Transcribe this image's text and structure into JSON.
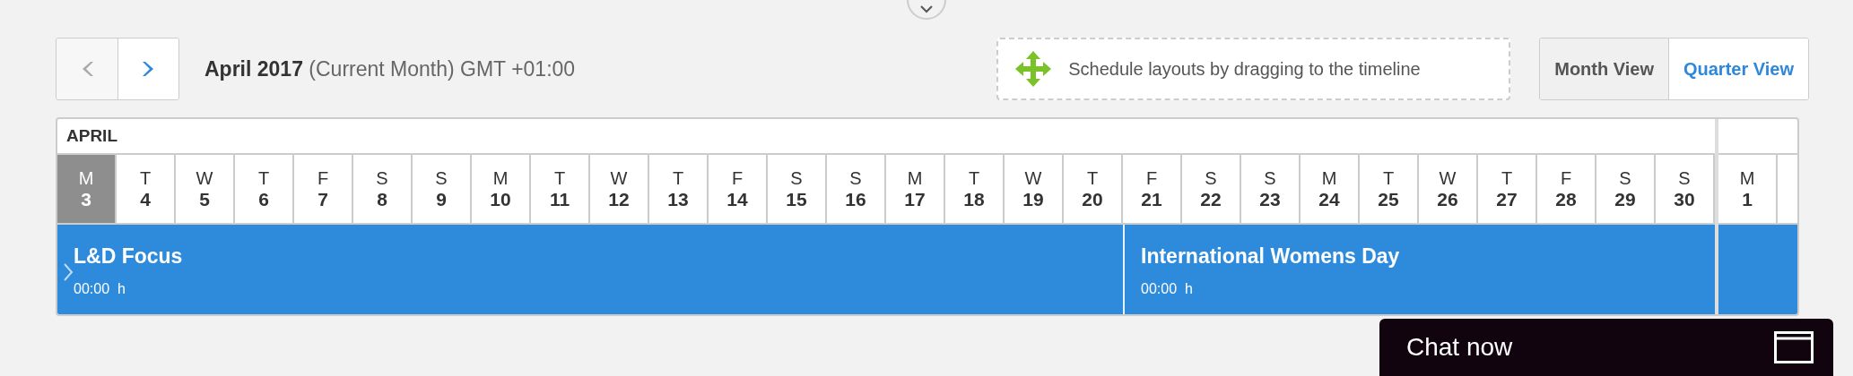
{
  "toolbar": {
    "prev_disabled": true,
    "title": "April 2017",
    "subtitle": "(Current Month) GMT +01:00",
    "hint": "Schedule layouts by dragging to the timeline",
    "views": [
      {
        "label": "Month View",
        "selected": true
      },
      {
        "label": "Quarter View",
        "selected": false
      }
    ]
  },
  "timeline": {
    "expanded": false,
    "months": [
      {
        "name": "APRIL",
        "days": [
          {
            "letter": "M",
            "date": "3",
            "today": true,
            "event": {
              "kind": "titled",
              "title": "L&D Focus",
              "time": "00:00  h"
            }
          },
          {
            "letter": "T",
            "date": "4",
            "today": false
          },
          {
            "letter": "W",
            "date": "5",
            "today": false
          },
          {
            "letter": "T",
            "date": "6",
            "today": false
          },
          {
            "letter": "F",
            "date": "7",
            "today": false
          },
          {
            "letter": "S",
            "date": "8",
            "today": false
          },
          {
            "letter": "S",
            "date": "9",
            "today": false
          },
          {
            "letter": "M",
            "date": "10",
            "today": false
          },
          {
            "letter": "T",
            "date": "11",
            "today": false
          },
          {
            "letter": "W",
            "date": "12",
            "today": false
          },
          {
            "letter": "T",
            "date": "13",
            "today": false
          },
          {
            "letter": "F",
            "date": "14",
            "today": false
          },
          {
            "letter": "S",
            "date": "15",
            "today": false
          },
          {
            "letter": "S",
            "date": "16",
            "today": false
          },
          {
            "letter": "M",
            "date": "17",
            "today": false
          },
          {
            "letter": "T",
            "date": "18",
            "today": false
          },
          {
            "letter": "W",
            "date": "19",
            "today": false
          },
          {
            "letter": "T",
            "date": "20",
            "today": false
          },
          {
            "letter": "F",
            "date": "21",
            "today": false,
            "event": {
              "kind": "titled",
              "title": "International Womens Day",
              "time": "00:00  h"
            }
          },
          {
            "letter": "S",
            "date": "22",
            "today": false
          },
          {
            "letter": "S",
            "date": "23",
            "today": false
          },
          {
            "letter": "M",
            "date": "24",
            "today": false
          },
          {
            "letter": "T",
            "date": "25",
            "today": false
          },
          {
            "letter": "W",
            "date": "26",
            "today": false
          },
          {
            "letter": "T",
            "date": "27",
            "today": false
          },
          {
            "letter": "F",
            "date": "28",
            "today": false
          },
          {
            "letter": "S",
            "date": "29",
            "today": false
          },
          {
            "letter": "S",
            "date": "30",
            "today": false
          }
        ]
      },
      {
        "days": [
          {
            "letter": "M",
            "date": "1",
            "today": false,
            "event": {
              "kind": "blank"
            }
          }
        ]
      }
    ]
  },
  "chat": {
    "label": "Chat now"
  }
}
